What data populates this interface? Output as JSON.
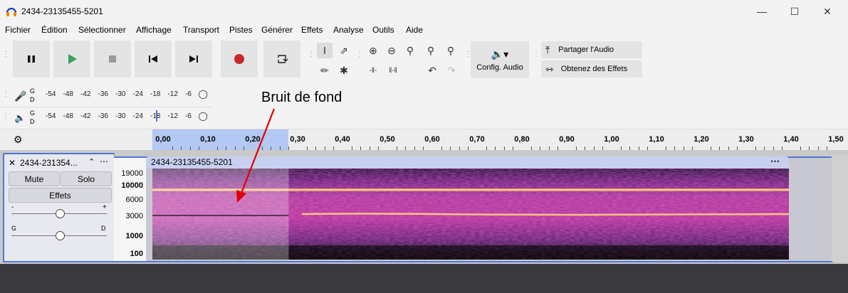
{
  "window": {
    "title": "2434-23135455-5201"
  },
  "menu": [
    "Fichier",
    "Édition",
    "Sélectionner",
    "Affichage",
    "Transport",
    "Pistes",
    "Générer",
    "Effets",
    "Analyse",
    "Outils",
    "Aide"
  ],
  "toolbar": {
    "audio_setup": "Config. Audio",
    "share_audio": "Partager l'Audio",
    "get_effects": "Obtenez des Effets"
  },
  "meters": {
    "record_labels": [
      "G",
      "D"
    ],
    "play_labels": [
      "G",
      "D"
    ],
    "record_scale": [
      "-54",
      "-48",
      "-42",
      "-36",
      "-30",
      "-24",
      "-18",
      "-12",
      "-6"
    ],
    "play_scale": [
      "-54",
      "-48",
      "-42",
      "-36",
      "-30",
      "-24",
      "-18",
      "-12",
      "-6"
    ]
  },
  "timeline": {
    "ticks": [
      "0,00",
      "0,10",
      "0,20",
      "0,30",
      "0,40",
      "0,50",
      "0,60",
      "0,70",
      "0,80",
      "0,90",
      "1,00",
      "1,10",
      "1,20",
      "1,30",
      "1,40",
      "1,50"
    ],
    "selection_start": 0.0,
    "selection_end": 0.28
  },
  "track": {
    "name": "2434-231354...",
    "clip_name": "2434-23135455-5201",
    "mute": "Mute",
    "solo": "Solo",
    "effects": "Effets",
    "gain_minus": "-",
    "gain_plus": "+",
    "pan_left": "G",
    "pan_right": "D",
    "scale_labels": [
      "19000",
      "10000",
      "6000",
      "3000",
      "1000",
      "100"
    ]
  },
  "annotation": {
    "text": "Bruit de fond",
    "color": "#e00000"
  },
  "colors": {
    "accent": "#4f78d6",
    "record": "#c62828",
    "play": "#3aa060"
  }
}
